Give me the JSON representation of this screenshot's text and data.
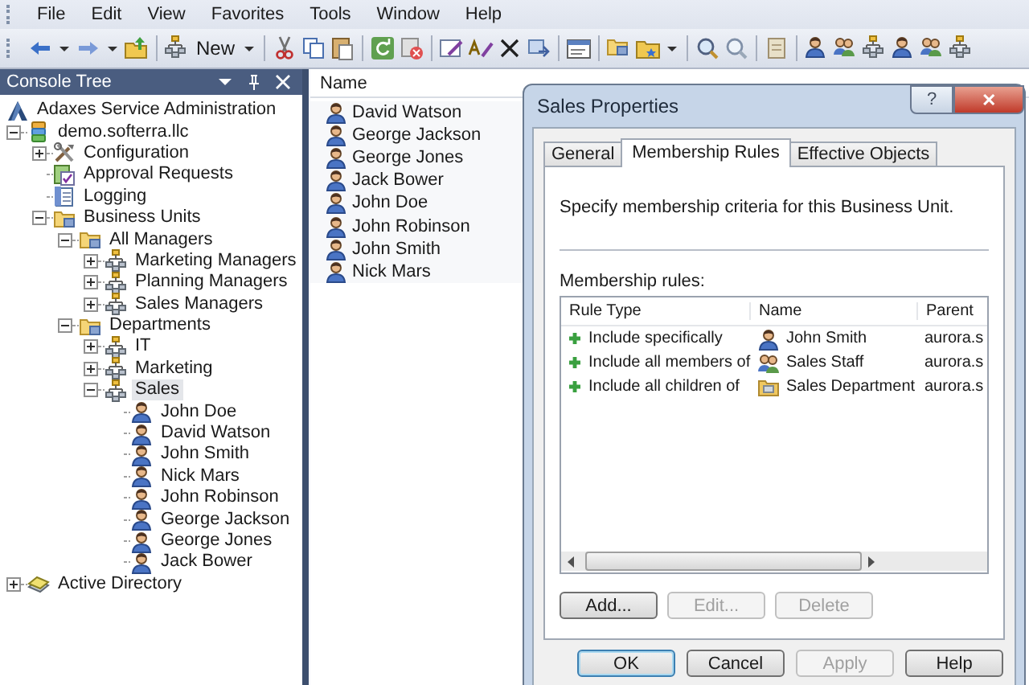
{
  "menu": [
    "File",
    "Edit",
    "View",
    "Favorites",
    "Tools",
    "Window",
    "Help"
  ],
  "toolbar": {
    "new_button": "New"
  },
  "console_tree": {
    "title": "Console Tree",
    "items": [
      {
        "label": "Adaxes Service Administration",
        "kind": "logo",
        "selected": false
      },
      {
        "label": "demo.softerra.llc",
        "kind": "database",
        "expanded": true,
        "selected": false,
        "children": [
          {
            "label": "Configuration",
            "kind": "tools",
            "expanded": false,
            "selected": false
          },
          {
            "label": "Approval Requests",
            "kind": "approval",
            "selected": false
          },
          {
            "label": "Logging",
            "kind": "log",
            "selected": false
          },
          {
            "label": "Business Units",
            "kind": "folder",
            "expanded": true,
            "selected": false,
            "children": [
              {
                "label": "All Managers",
                "kind": "folder",
                "expanded": true,
                "selected": false,
                "children": [
                  {
                    "label": "Marketing Managers",
                    "kind": "unit",
                    "expanded": false,
                    "selected": false
                  },
                  {
                    "label": "Planning Managers",
                    "kind": "unit",
                    "expanded": false,
                    "selected": false
                  },
                  {
                    "label": "Sales Managers",
                    "kind": "unit",
                    "expanded": false,
                    "selected": false
                  }
                ]
              },
              {
                "label": "Departments",
                "kind": "folder",
                "expanded": true,
                "selected": false,
                "children": [
                  {
                    "label": "IT",
                    "kind": "unit",
                    "expanded": false,
                    "selected": false
                  },
                  {
                    "label": "Marketing",
                    "kind": "unit",
                    "expanded": false,
                    "selected": false
                  },
                  {
                    "label": "Sales",
                    "kind": "unit",
                    "expanded": true,
                    "selected": true,
                    "children": [
                      {
                        "label": "John Doe",
                        "kind": "user",
                        "selected": false
                      },
                      {
                        "label": "David Watson",
                        "kind": "user",
                        "selected": false
                      },
                      {
                        "label": "John Smith",
                        "kind": "user",
                        "selected": false
                      },
                      {
                        "label": "Nick Mars",
                        "kind": "user",
                        "selected": false
                      },
                      {
                        "label": "John Robinson",
                        "kind": "user",
                        "selected": false
                      },
                      {
                        "label": "George Jackson",
                        "kind": "user",
                        "selected": false
                      },
                      {
                        "label": "George Jones",
                        "kind": "user",
                        "selected": false
                      },
                      {
                        "label": "Jack Bower",
                        "kind": "user",
                        "selected": false
                      }
                    ]
                  }
                ]
              }
            ]
          }
        ]
      },
      {
        "label": "Active Directory",
        "kind": "directory",
        "expanded": false,
        "selected": false
      }
    ]
  },
  "list": {
    "columns": [
      "Name"
    ],
    "rows": [
      "David Watson",
      "George Jackson",
      "George Jones",
      "Jack Bower",
      "John Doe",
      "John Robinson",
      "John Smith",
      "Nick Mars"
    ]
  },
  "dialog": {
    "title": "Sales Properties",
    "help": "?",
    "close": "✕",
    "tabs": [
      {
        "label": "General",
        "selected": false
      },
      {
        "label": "Membership Rules",
        "selected": true
      },
      {
        "label": "Effective Objects",
        "selected": false
      }
    ],
    "description": "Specify membership criteria for this Business Unit.",
    "rules_label": "Membership rules:",
    "rules_columns": [
      "Rule Type",
      "Name",
      "Parent"
    ],
    "rules": [
      {
        "rule_type": "Include specifically",
        "name": "John Smith",
        "kind": "user",
        "parent": "aurora.s"
      },
      {
        "rule_type": "Include all members of",
        "name": "Sales Staff",
        "kind": "group",
        "parent": "aurora.s"
      },
      {
        "rule_type": "Include all children of",
        "name": "Sales Department",
        "kind": "container",
        "parent": "aurora.s"
      }
    ],
    "rule_buttons": [
      {
        "label": "Add...",
        "disabled": false
      },
      {
        "label": "Edit...",
        "disabled": true
      },
      {
        "label": "Delete",
        "disabled": true
      }
    ],
    "buttons": [
      {
        "label": "OK",
        "disabled": false,
        "default": true
      },
      {
        "label": "Cancel",
        "disabled": false,
        "default": false
      },
      {
        "label": "Apply",
        "disabled": true,
        "default": false
      },
      {
        "label": "Help",
        "disabled": false,
        "default": false
      }
    ]
  }
}
